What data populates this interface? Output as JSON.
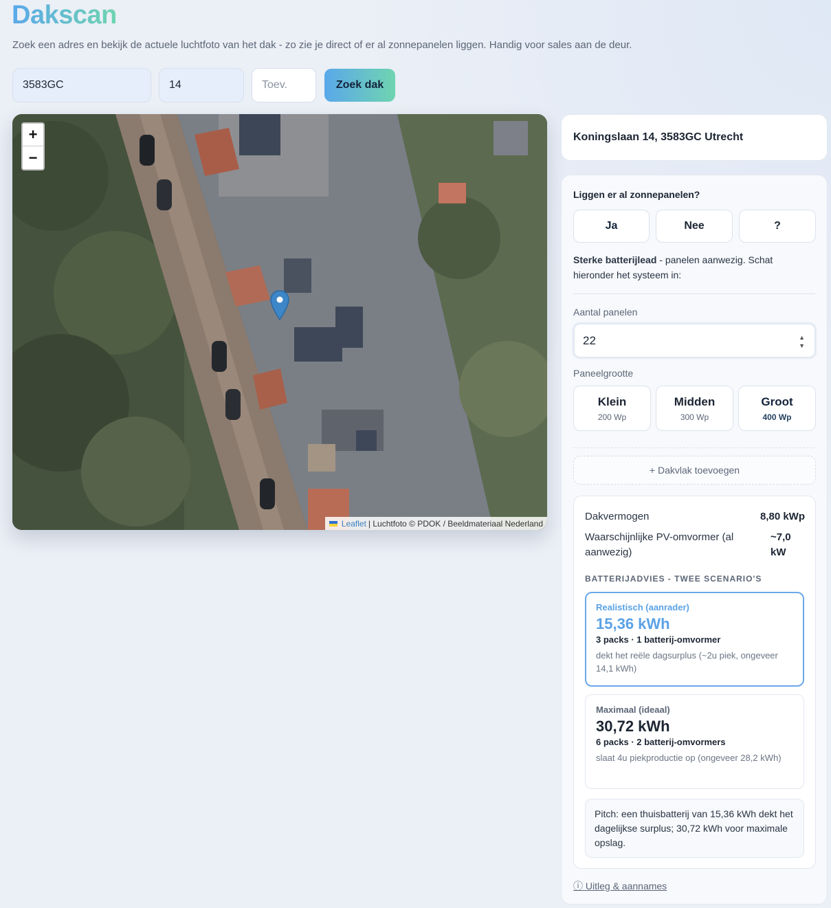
{
  "header": {
    "title": "Dakscan",
    "subtitle": "Zoek een adres en bekijk de actuele luchtfoto van het dak - zo zie je direct of er al zonnepanelen liggen. Handig voor sales aan de deur."
  },
  "search": {
    "postcode": "3583GC",
    "housenumber": "14",
    "addition_placeholder": "Toev.",
    "button_label": "Zoek dak"
  },
  "map": {
    "zoom_in": "+",
    "zoom_out": "−",
    "attribution_link": "Leaflet",
    "attribution_text": "| Luchtfoto © PDOK / Beeldmateriaal Nederland"
  },
  "address": "Koningslaan 14, 3583GC Utrecht",
  "panels_question": {
    "question": "Liggen er al zonnepanelen?",
    "options": [
      "Ja",
      "Nee",
      "?"
    ],
    "selected": "Ja",
    "lead_bold": "Sterke batterijlead",
    "lead_text": " - panelen aanwezig. Schat hieronder het systeem in:"
  },
  "panel_count": {
    "label": "Aantal panelen",
    "value": "22"
  },
  "panel_size": {
    "label": "Paneelgrootte",
    "options": [
      {
        "name": "Klein",
        "wp": "200 Wp"
      },
      {
        "name": "Midden",
        "wp": "300 Wp"
      },
      {
        "name": "Groot",
        "wp": "400 Wp"
      }
    ],
    "selected": "Groot"
  },
  "add_roof_label": "+ Dakvlak toevoegen",
  "results": {
    "dakvermogen_label": "Dakvermogen",
    "dakvermogen_value": "8,80 kWp",
    "omvormer_label": "Waarschijnlijke PV-omvormer (al aanwezig)",
    "omvormer_value": "~7,0 kW",
    "section_title": "BATTERIJADVIES - TWEE SCENARIO'S",
    "scenarios": [
      {
        "name": "Realistisch (aanrader)",
        "kwh": "15,36 kWh",
        "packs": "3 packs · 1 batterij-omvormer",
        "desc": "dekt het reële dagsurplus (~2u piek, ongeveer 14,1 kWh)"
      },
      {
        "name": "Maximaal (ideaal)",
        "kwh": "30,72 kWh",
        "packs": "6 packs · 2 batterij-omvormers",
        "desc": "slaat 4u piekproductie op (ongeveer 28,2 kWh)"
      }
    ],
    "pitch": "Pitch: een thuisbatterij van 15,36 kWh dekt het dagelijkse surplus; 30,72 kWh voor maximale opslag."
  },
  "uitleg_label": "ⓘ Uitleg & aannames",
  "colors": {
    "accent_start": "#5aa8ea",
    "accent_end": "#6fd4b0"
  }
}
